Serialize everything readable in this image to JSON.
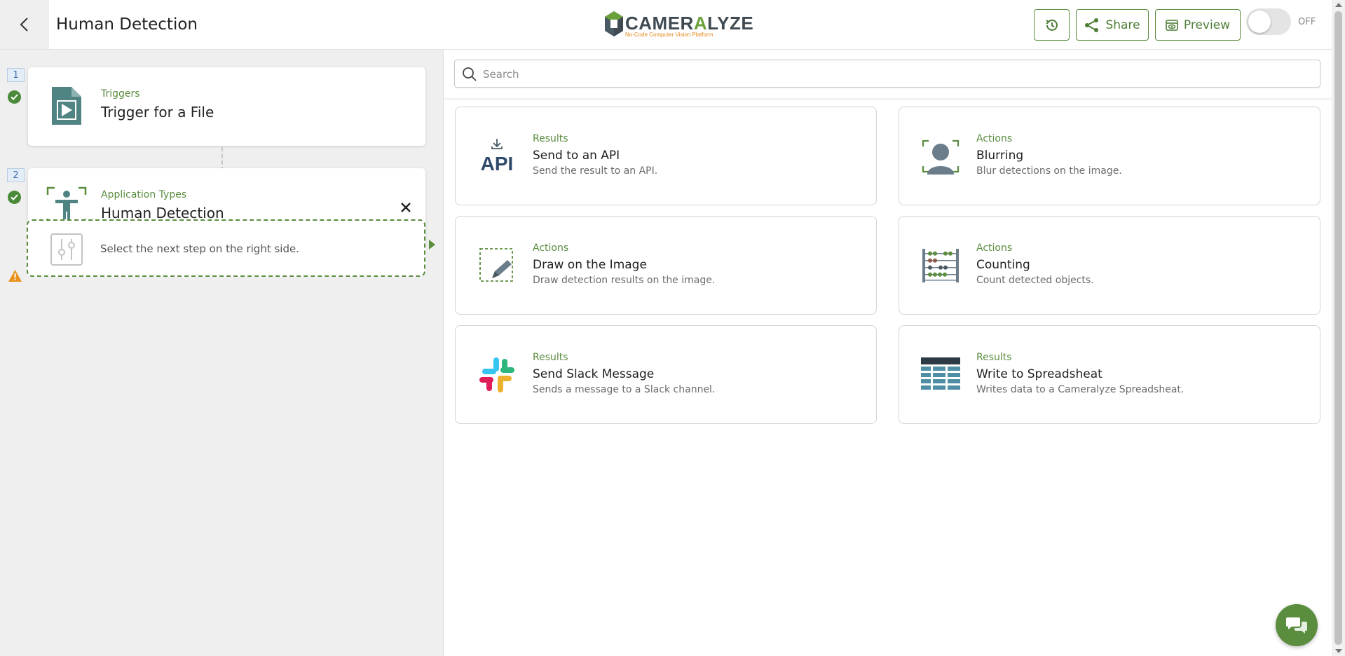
{
  "header": {
    "title": "Human Detection",
    "logo": {
      "word_main": "CAMER",
      "word_accent": "A",
      "word_end": "LYZE",
      "tagline": "No-Code Computer Vision Platform"
    },
    "buttons": {
      "share": "Share",
      "preview": "Preview"
    },
    "toggle": {
      "state": "OFF"
    }
  },
  "steps": [
    {
      "number": "1",
      "category": "Triggers",
      "title": "Trigger for a File",
      "icon": "file-play-icon",
      "status": "complete"
    },
    {
      "number": "2",
      "category": "Application Types",
      "title": "Human Detection",
      "icon": "human-detection-icon",
      "status": "complete"
    }
  ],
  "next_step": {
    "text": "Select the next step on the right side.",
    "status": "warning"
  },
  "search": {
    "placeholder": "Search",
    "value": ""
  },
  "actions": [
    {
      "category": "Results",
      "title": "Send to an API",
      "description": "Send the result to an API.",
      "icon": "api-icon"
    },
    {
      "category": "Actions",
      "title": "Blurring",
      "description": "Blur detections on the image.",
      "icon": "blur-person-icon"
    },
    {
      "category": "Actions",
      "title": "Draw on the Image",
      "description": "Draw detection results on the image.",
      "icon": "draw-pencil-icon"
    },
    {
      "category": "Actions",
      "title": "Counting",
      "description": "Count detected objects.",
      "icon": "abacus-icon"
    },
    {
      "category": "Results",
      "title": "Send Slack Message",
      "description": "Sends a message to a Slack channel.",
      "icon": "slack-icon"
    },
    {
      "category": "Results",
      "title": "Write to Spreadsheat",
      "description": "Writes data to a Cameralyze Spreadsheat.",
      "icon": "spreadsheet-icon"
    }
  ],
  "colors": {
    "accent": "#5b8d3f",
    "step_icon": "#4f8483",
    "warning": "#e8921c"
  }
}
